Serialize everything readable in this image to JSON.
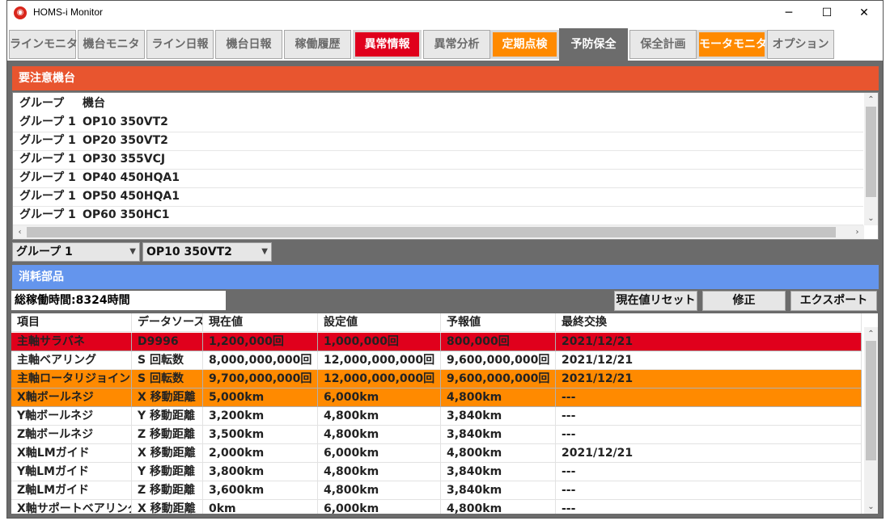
{
  "window": {
    "title": "HOMS-i Monitor",
    "minimize": "─",
    "maximize": "☐",
    "close": "✕"
  },
  "tabs": [
    {
      "label": "ラインモニタ",
      "style": "normal"
    },
    {
      "label": "機台モニタ",
      "style": "normal"
    },
    {
      "label": "ライン日報",
      "style": "normal"
    },
    {
      "label": "機台日報",
      "style": "normal"
    },
    {
      "label": "稼働履歴",
      "style": "normal"
    },
    {
      "label": "異常情報",
      "style": "red"
    },
    {
      "label": "異常分析",
      "style": "normal"
    },
    {
      "label": "定期点検",
      "style": "orange"
    },
    {
      "label": "予防保全",
      "style": "active"
    },
    {
      "label": "保全計画",
      "style": "normal"
    },
    {
      "label": "モータモニタ",
      "style": "orange"
    },
    {
      "label": "オプション",
      "style": "normal"
    }
  ],
  "attention": {
    "header": "要注意機台",
    "columns": [
      "グループ",
      "機台"
    ],
    "rows": [
      [
        "グループ 1",
        "OP10 350VT2"
      ],
      [
        "グループ 1",
        "OP20 350VT2"
      ],
      [
        "グループ 1",
        "OP30 355VCJ"
      ],
      [
        "グループ 1",
        "OP40 450HQA1"
      ],
      [
        "グループ 1",
        "OP50 450HQA1"
      ],
      [
        "グループ 1",
        "OP60 350HC1"
      ]
    ]
  },
  "selectors": {
    "group": "グループ 1",
    "machine": "OP10 350VT2"
  },
  "consumables": {
    "header": "消耗部品",
    "total_time": "総稼働時間:8324時間",
    "buttons": {
      "reset": "現在値リセット",
      "edit": "修正",
      "export": "エクスポート"
    },
    "columns": [
      "項目",
      "データソース",
      "現在値",
      "設定値",
      "予報値",
      "最終交換"
    ],
    "rows": [
      {
        "status": "red",
        "cells": [
          "主軸サラバネ",
          "D9996",
          "1,200,000回",
          "1,000,000回",
          "800,000回",
          "2021/12/21"
        ]
      },
      {
        "status": "normal",
        "cells": [
          "主軸ベアリング",
          "S 回転数",
          "8,000,000,000回",
          "12,000,000,000回",
          "9,600,000,000回",
          "2021/12/21"
        ]
      },
      {
        "status": "orange",
        "cells": [
          "主軸ロータリジョイント",
          "S 回転数",
          "9,700,000,000回",
          "12,000,000,000回",
          "9,600,000,000回",
          "2021/12/21"
        ]
      },
      {
        "status": "orange",
        "cells": [
          "X軸ボールネジ",
          "X 移動距離",
          "5,000km",
          "6,000km",
          "4,800km",
          "---"
        ]
      },
      {
        "status": "normal",
        "cells": [
          "Y軸ボールネジ",
          "Y 移動距離",
          "3,200km",
          "4,800km",
          "3,840km",
          "---"
        ]
      },
      {
        "status": "normal",
        "cells": [
          "Z軸ボールネジ",
          "Z 移動距離",
          "3,500km",
          "4,800km",
          "3,840km",
          "---"
        ]
      },
      {
        "status": "normal",
        "cells": [
          "X軸LMガイド",
          "X 移動距離",
          "2,000km",
          "6,000km",
          "4,800km",
          "2021/12/21"
        ]
      },
      {
        "status": "normal",
        "cells": [
          "Y軸LMガイド",
          "Y 移動距離",
          "3,800km",
          "4,800km",
          "3,840km",
          "---"
        ]
      },
      {
        "status": "normal",
        "cells": [
          "Z軸LMガイド",
          "Z 移動距離",
          "3,600km",
          "4,800km",
          "3,840km",
          "---"
        ]
      },
      {
        "status": "normal",
        "cells": [
          "X軸サポートベアリング",
          "X 移動距離",
          "0km",
          "6,000km",
          "4,800km",
          "---"
        ]
      }
    ]
  },
  "colors": {
    "red_header": "#e8552f",
    "blue_header": "#6495ed",
    "alert_red": "#e0001c",
    "warn_orange": "#ff8a00"
  }
}
